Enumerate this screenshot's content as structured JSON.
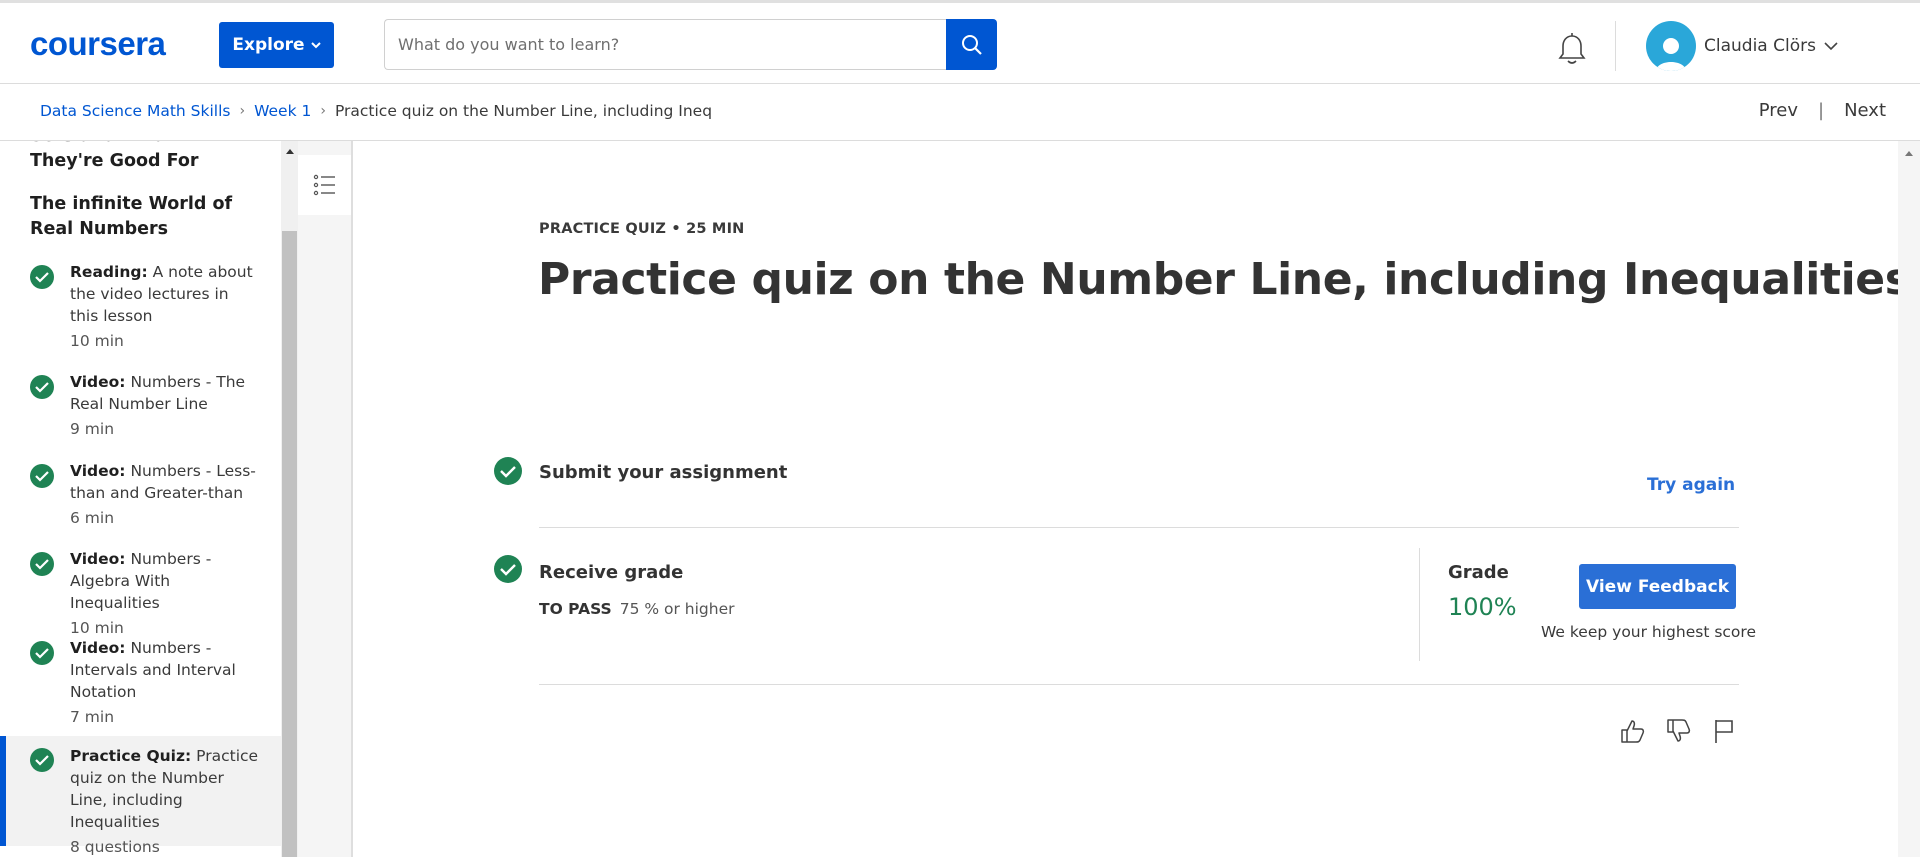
{
  "header": {
    "logo": "coursera",
    "explore_label": "Explore",
    "search_placeholder": "What do you want to learn?",
    "user_name": "Claudia Clörs"
  },
  "breadcrumb": {
    "course": "Data Science Math Skills",
    "week": "Week 1",
    "current": "Practice quiz on the Number Line, including Inequalities"
  },
  "nav": {
    "prev": "Prev",
    "separator": "|",
    "next": "Next"
  },
  "sidebar": {
    "prev_heading": "Sets and What They're Good For",
    "section_heading": "The infinite World of Real Numbers",
    "items": [
      {
        "type": "Reading:",
        "title": "A note about the video lectures in this lesson",
        "duration": "10 min"
      },
      {
        "type": "Video:",
        "title": "Numbers - The Real Number Line",
        "duration": "9 min"
      },
      {
        "type": "Video:",
        "title": "Numbers - Less-than and Greater-than",
        "duration": "6 min"
      },
      {
        "type": "Video:",
        "title": "Numbers - Algebra With Inequalities",
        "duration": "10 min"
      },
      {
        "type": "Video:",
        "title": "Numbers - Intervals and Interval Notation",
        "duration": "7 min"
      },
      {
        "type": "Practice Quiz:",
        "title": "Practice quiz on the Number Line, including Inequalities",
        "duration": "8 questions"
      }
    ]
  },
  "main": {
    "overline": "PRACTICE QUIZ • 25 MIN",
    "title": "Practice quiz on the Number Line, including Inequalities",
    "submit_title": "Submit your assignment",
    "try_again": "Try again",
    "receive_title": "Receive grade",
    "to_pass_label": "TO PASS",
    "to_pass_value": "75 % or higher",
    "grade_label": "Grade",
    "grade_value": "100%",
    "view_feedback": "View Feedback",
    "keep_highest": "We keep your highest score"
  },
  "colors": {
    "brand_blue": "#0056d2",
    "success_green": "#1f8354",
    "link_blue": "#2a6fd6"
  }
}
